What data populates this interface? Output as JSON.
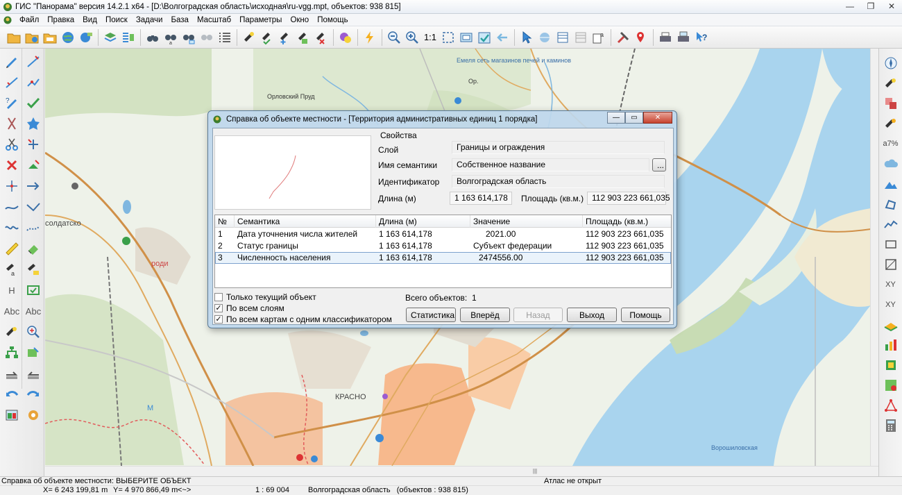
{
  "window": {
    "title": "ГИС \"Панорама\" версия 14.2.1 x64 - [D:\\Волгоградская область\\исходная\\ru-vgg.mpt, объектов: 938 815]"
  },
  "menu": [
    "Файл",
    "Правка",
    "Вид",
    "Поиск",
    "Задачи",
    "База",
    "Масштаб",
    "Параметры",
    "Окно",
    "Помощь"
  ],
  "toolbar": {
    "scale_one": "1:1"
  },
  "left_tools": {
    "h_text": "H",
    "abc1": "Abc",
    "abc2": "Abc"
  },
  "right_tools": {
    "percent_text": "a7%",
    "xy_text": "XY",
    "xy2_text": "XY"
  },
  "map": {
    "labels": {
      "orlovsky": "Орловский Пруд",
      "emelya": "Емеля сеть магазинов печей и каминов",
      "orel": "Ор.",
      "soldatsko": "солдатско",
      "krasno": "КРАСНО",
      "rodi": "роди",
      "m": "М",
      "voroshilov": "Ворошиловская"
    }
  },
  "dialog": {
    "title": "Справка об объекте местности  - [Территория административных единиц 1 порядка]",
    "properties_caption": "Свойства",
    "layer_label": "Слой",
    "layer_value": "Границы и ограждения",
    "semantic_name_label": "Имя семантики",
    "semantic_name_value": "Собственное название",
    "dots_button": "...",
    "identifier_label": "Идентификатор",
    "identifier_value": "Волгоградская область",
    "length_label": "Длина (м)",
    "length_value": "1 163 614,178",
    "area_label": "Площадь (кв.м.)",
    "area_value": "112 903 223 661,035",
    "table": {
      "headers": [
        "№",
        "Семантика",
        "Длина (м)",
        "Значение",
        "Площадь (кв.м.)"
      ],
      "rows": [
        {
          "n": "1",
          "semantic": "Дата уточнения числа жителей",
          "length": "1 163 614,178",
          "value": "2021.00",
          "area": "112 903 223 661,035"
        },
        {
          "n": "2",
          "semantic": "Статус границы",
          "length": "1 163 614,178",
          "value": "Субъект федерации",
          "area": "112 903 223 661,035"
        },
        {
          "n": "3",
          "semantic": "Численность населения",
          "length": "1 163 614,178",
          "value": "2474556.00",
          "area": "112 903 223 661,035"
        }
      ]
    },
    "checkboxes": [
      {
        "label": "Только текущий объект",
        "checked": false
      },
      {
        "label": "По всем слоям",
        "checked": true
      },
      {
        "label": "По всем картам с одним классификатором",
        "checked": true
      }
    ],
    "total_label": "Всего объектов:",
    "total_value": "1",
    "buttons": {
      "statistics": "Статистика",
      "forward": "Вперёд",
      "back": "Назад",
      "exit": "Выход",
      "help": "Помощь"
    },
    "check_mark": "✓"
  },
  "status": {
    "hint": "Справка об объекте местности: ВЫБЕРИТЕ ОБЪЕКТ",
    "atlas": "Атлас не открыт",
    "x": "X= 6 243 199,81 m",
    "y": "Y= 4 970 866,49 m",
    "arrows": "<~>",
    "scale": "1 : 69 004",
    "region": "Волгоградская область   (объектов : 938 815)"
  },
  "colors": {
    "water": "#a9d4ee",
    "urban": "#f7b98d",
    "forest": "#c8dcb4",
    "road": "#d09048",
    "dialog_frame": "#bed7eb"
  }
}
